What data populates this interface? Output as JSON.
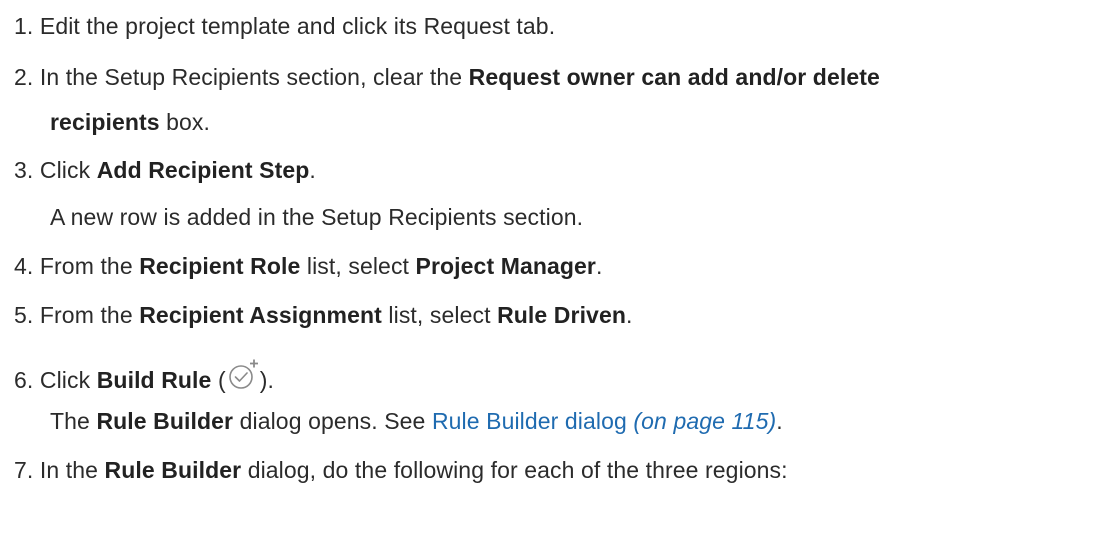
{
  "steps": [
    {
      "num": "1.",
      "text": "Edit the project template and click its Request tab."
    },
    {
      "num": "2.",
      "pre": "In the Setup Recipients section, clear the ",
      "bold1": "Request owner can add and/or delete",
      "bold2": "recipients",
      "post": " box."
    },
    {
      "num": "3.",
      "pre": "Click ",
      "bold": "Add Recipient Step",
      "post": "."
    },
    {
      "note": "A new row is added in the Setup Recipients section."
    },
    {
      "num": "4.",
      "pre": "From the ",
      "bold1": "Recipient Role",
      "mid": " list, select ",
      "bold2": "Project Manager",
      "post": "."
    },
    {
      "num": "5.",
      "pre": "From the ",
      "bold1": "Recipient Assignment",
      "mid": " list, select ",
      "bold2": "Rule Driven",
      "post": "."
    },
    {
      "num": "6.",
      "pre": "Click ",
      "bold": "Build Rule",
      "open": " (",
      "close": ")."
    },
    {
      "pre": "The ",
      "bold": "Rule Builder",
      "mid": " dialog opens. See ",
      "link": "Rule Builder dialog",
      "link_page": "(on page 115)",
      "post": "."
    },
    {
      "num": "7.",
      "pre": "In the ",
      "bold": "Rule Builder",
      "post": " dialog, do the following for each of the three regions:"
    }
  ],
  "icons": {
    "build_rule": "build-rule-icon"
  },
  "colors": {
    "text": "#2b2b2b",
    "link": "#1f6bb0",
    "icon": "#8a8a8a"
  }
}
